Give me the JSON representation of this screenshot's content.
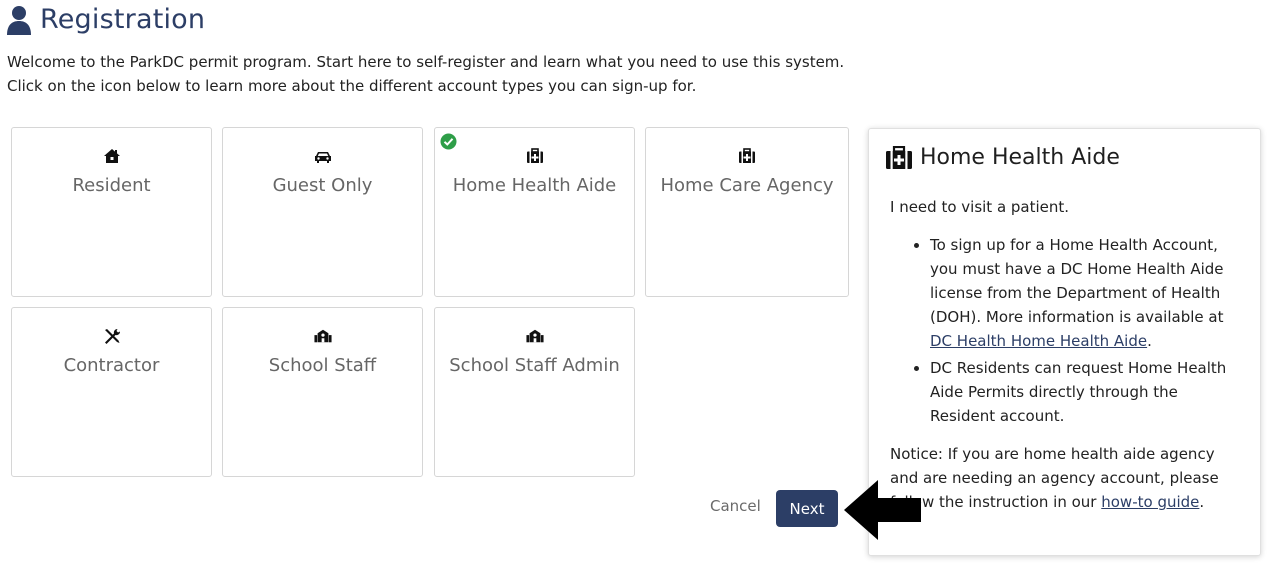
{
  "header": {
    "title": "Registration",
    "icon": "user-icon"
  },
  "intro": {
    "line1": "Welcome to the ParkDC permit program. Start here to self-register and learn what you need to use this system.",
    "line2": "Click on the icon below to learn more about the different account types you can sign-up for."
  },
  "account_types": [
    {
      "label": "Resident",
      "icon": "home-icon",
      "selected": false
    },
    {
      "label": "Guest Only",
      "icon": "car-icon",
      "selected": false
    },
    {
      "label": "Home Health Aide",
      "icon": "medical-kit-icon",
      "selected": true
    },
    {
      "label": "Home Care Agency",
      "icon": "medical-kit-icon",
      "selected": false
    },
    {
      "label": "Contractor",
      "icon": "tools-icon",
      "selected": false
    },
    {
      "label": "School Staff",
      "icon": "school-icon",
      "selected": false
    },
    {
      "label": "School Staff Admin",
      "icon": "school-icon",
      "selected": false
    }
  ],
  "panel": {
    "icon": "medical-kit-icon",
    "title": "Home Health Aide",
    "intro": "I need to visit a patient.",
    "bullet1_text": "To sign up for a Home Health Account, you must have a DC Home Health Aide license from the Department of Health (DOH). More information is available at ",
    "bullet1_link": "DC Health Home Health Aide",
    "bullet1_end": ".",
    "bullet2": "DC Residents can request Home Health Aide Permits directly through the Resident account.",
    "notice_text": "Notice: If you are home health aide agency and are needing an agency account, please follow the instruction in our ",
    "notice_link": "how-to guide",
    "notice_end": "."
  },
  "actions": {
    "cancel_label": "Cancel",
    "next_label": "Next"
  },
  "colors": {
    "brand": "#2c3e66",
    "check": "#2e9e48",
    "label_gray": "#666666"
  }
}
